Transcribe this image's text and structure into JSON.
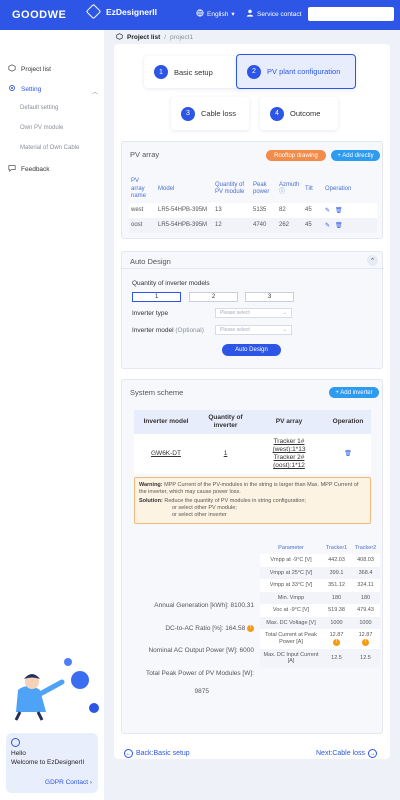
{
  "header": {
    "logo": "GOODWE",
    "brand": "EzDesignerII",
    "language": "English",
    "service": "Service contact",
    "search_value": ""
  },
  "sidebar": {
    "items": [
      {
        "label": "Project list"
      },
      {
        "label": "Setting"
      },
      {
        "label": "Default setting"
      },
      {
        "label": "Own PV module"
      },
      {
        "label": "Material of Own Cable"
      },
      {
        "label": "Feedback"
      }
    ],
    "hello_title": "Hello",
    "hello_sub": "Welcome to EzDesignerII",
    "gdpr": "GDPR Contact"
  },
  "breadcrumb": {
    "root": "Project list",
    "sep": "/",
    "current": "project1"
  },
  "steps": [
    {
      "num": "1",
      "label": "Basic setup"
    },
    {
      "num": "2",
      "label": "PV plant configuration"
    },
    {
      "num": "3",
      "label": "Cable loss"
    },
    {
      "num": "4",
      "label": "Outcome"
    }
  ],
  "pv_array": {
    "title": "PV array",
    "rooftop_btn": "Rooftop drawing",
    "add_btn": "+ Add directly",
    "headers": [
      "PV array name",
      "Model",
      "Quantity of PV module",
      "Peak power",
      "Azmuth",
      "Tilt",
      "Operation"
    ],
    "rows": [
      {
        "name": "west",
        "model": "LR5-54HPB-395M",
        "qty": "13",
        "peak": "5135",
        "azimuth": "82",
        "tilt": "45"
      },
      {
        "name": "oost",
        "model": "LR5-54HPB-395M",
        "qty": "12",
        "peak": "4740",
        "azimuth": "262",
        "tilt": "45"
      }
    ]
  },
  "auto_design": {
    "title": "Auto Design",
    "qty_label": "Quantity of inverter models",
    "qty_options": [
      "1",
      "2",
      "3"
    ],
    "inv_type_label": "Inverter type",
    "inv_model_label": "Inverter model",
    "optional": "(Optional)",
    "placeholder": "Please select",
    "button": "Auto Design"
  },
  "system_scheme": {
    "title": "System scheme",
    "add_inverter": "+ Add inverter",
    "headers": [
      "Inverter model",
      "Quantity of inverter",
      "PV array",
      "Operation"
    ],
    "row": {
      "model": "GW6K-DT",
      "qty": "1",
      "arrays": [
        "Tracker 1#",
        "(west):1*13",
        "Tracker 2#",
        "(oost):1*12"
      ]
    },
    "warning_label": "Warning:",
    "warning_text": "MPP Current of the PV-modules in the string is larger than Max. MPP Current of the inverter, which may cause power loss.",
    "solution_label": "Solution:",
    "solution_lines": [
      "Reduce the quantity of PV modules in string configuration;",
      "or select other PV module;",
      "or select other inverter"
    ],
    "stats": [
      {
        "label": "Annual Generation [kWh]:",
        "value": "8100.31"
      },
      {
        "label": "DC-to-AC Ratio [%]:",
        "value": "164.58"
      },
      {
        "label": "Nominal AC Output Power [W]:",
        "value": "6000"
      },
      {
        "label": "Total Peak Power of PV Modules [W]:",
        "value": "9875"
      }
    ],
    "params_headers": [
      "Parameter",
      "Tracker1",
      "Tracker2"
    ],
    "params": [
      {
        "p": "Vmpp at -9°C [V]",
        "t1": "442.03",
        "t2": "408.03"
      },
      {
        "p": "Vmpp at 25°C [V]",
        "t1": "399.1",
        "t2": "368.4"
      },
      {
        "p": "Vmpp at 33°C [V]",
        "t1": "351.12",
        "t2": "324.11"
      },
      {
        "p": "Min. Vmpp",
        "t1": "180",
        "t2": "180"
      },
      {
        "p": "Voc at -9°C [V]",
        "t1": "519.38",
        "t2": "479.43"
      },
      {
        "p": "Max. DC Voltage [V]",
        "t1": "1000",
        "t2": "1000"
      },
      {
        "p": "Total Current at Peak Power [A]",
        "t1": "12.87",
        "t2": "12.87"
      },
      {
        "p": "Max. DC Input Current [A]",
        "t1": "12.5",
        "t2": "12.5"
      }
    ]
  },
  "nav": {
    "back": "Back:Basic setup",
    "next": "Next:Cable loss"
  }
}
